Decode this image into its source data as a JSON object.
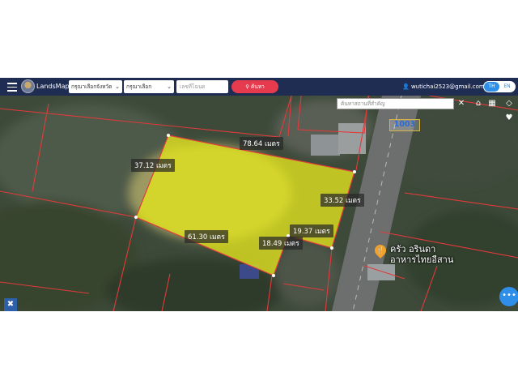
{
  "app": {
    "brand": "LandsMaps",
    "province_select": "กรุณาเลือกจังหวัด",
    "district_select": "กรุณาเลือกอำเภอ",
    "deed_placeholder": "เลขที่โฉนด",
    "search_label": "ค้นหา",
    "user_email": "wutichai2523@gmail.com",
    "lang_th": "TH",
    "lang_en": "EN"
  },
  "map": {
    "place_search_placeholder": "ค้นหาสถานที่สำคัญ",
    "parcel_number": "1003",
    "measurements": {
      "top": "78.64 เมตร",
      "left": "37.12 เมตร",
      "right": "33.52 เมตร",
      "bottom_left": "61.30 เมตร",
      "inner_right": "19.37 เมตร",
      "inner_bottom": "18.49 เมตร"
    },
    "poi": {
      "line1": "ครัว อรินดา",
      "line2": "อาหารไทยอีสาน"
    }
  },
  "icons": {
    "menu": "hamburger-icon",
    "search": "search-icon",
    "user": "user-icon",
    "close": "close-icon",
    "home": "home-icon",
    "grid": "grid-icon",
    "layers": "layers-icon",
    "heart": "heart-icon",
    "more": "more-icon",
    "tool": "satellite-icon"
  },
  "colors": {
    "topbar": "#1f2d52",
    "search_button": "#e63b4f",
    "parcel_fill": "#e4e61e",
    "boundary": "#e23a3a",
    "accent": "#2f8fe8"
  }
}
